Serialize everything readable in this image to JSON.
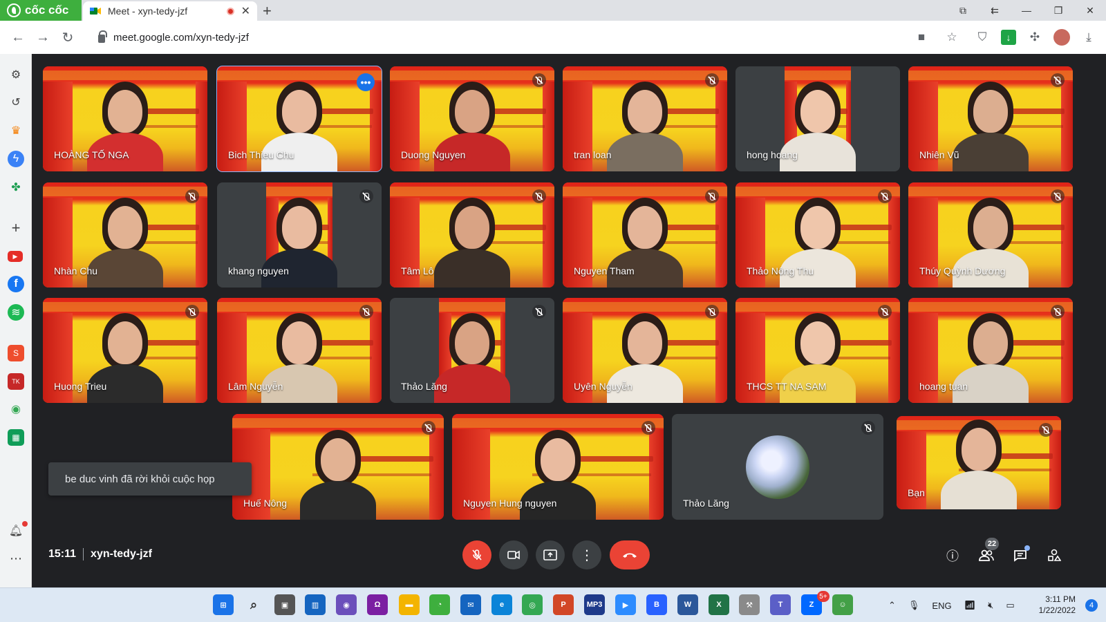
{
  "browser": {
    "brand": "cốc cốc",
    "tab_title": "Meet - xyn-tedy-jzf",
    "url": "meet.google.com/xyn-tedy-jzf",
    "icons": [
      "back-icon",
      "forward-icon",
      "reload-icon",
      "lock-icon",
      "camera-icon",
      "star-icon",
      "shield-icon",
      "download-icon",
      "extensions-icon",
      "avatar",
      "download-tray-icon"
    ]
  },
  "sidebar": {
    "items": [
      "settings-icon",
      "history-icon",
      "crown-icon",
      "messenger-icon",
      "game-icon",
      "add-icon",
      "youtube-icon",
      "facebook-icon",
      "spotify-icon",
      "shopee-icon",
      "tiki-icon",
      "map-icon",
      "sheets-icon",
      "bell-icon",
      "more-icon"
    ]
  },
  "participants": [
    {
      "name": "HOÀNG TỐ NGA"
    },
    {
      "name": "Bich Thieu Chu"
    },
    {
      "name": "Duong Nguyen"
    },
    {
      "name": "tran loan"
    },
    {
      "name": "hong hoang"
    },
    {
      "name": "Nhiên Vũ"
    },
    {
      "name": "Nhàn Chu"
    },
    {
      "name": "khang nguyen"
    },
    {
      "name": "Tâm Lô"
    },
    {
      "name": "Nguyen Tham"
    },
    {
      "name": "Thảo Nông Thu"
    },
    {
      "name": "Thúy Quỳnh Dương"
    },
    {
      "name": "Huong Trieu"
    },
    {
      "name": "Lâm Nguyễn"
    },
    {
      "name": "Thảo Lăng"
    },
    {
      "name": "Uyên Nguyễn"
    },
    {
      "name": "THCS TT NA SAM"
    },
    {
      "name": "hoang tuan"
    },
    {
      "name": "Huế Nông"
    },
    {
      "name": "Nguyen Hung nguyen"
    },
    {
      "name": "Thảo Lăng"
    },
    {
      "name": "Bạn"
    }
  ],
  "toast": "be duc vinh đã rời khỏi cuộc họp",
  "meeting": {
    "time": "15:11",
    "code": "xyn-tedy-jzf",
    "participant_count": "22"
  },
  "taskbar": {
    "lang": "ENG",
    "time": "3:11 PM",
    "date": "1/22/2022",
    "notifications": "4",
    "zalo_badge": "5+",
    "apps": [
      "start",
      "search",
      "task-view",
      "widgets",
      "teams-chat",
      "headphones",
      "explorer",
      "coccoc",
      "mail",
      "edge",
      "chrome",
      "powerpoint",
      "mp3cut",
      "zoom",
      "b-app",
      "word",
      "excel",
      "tool",
      "teams",
      "zalo",
      "people"
    ]
  }
}
